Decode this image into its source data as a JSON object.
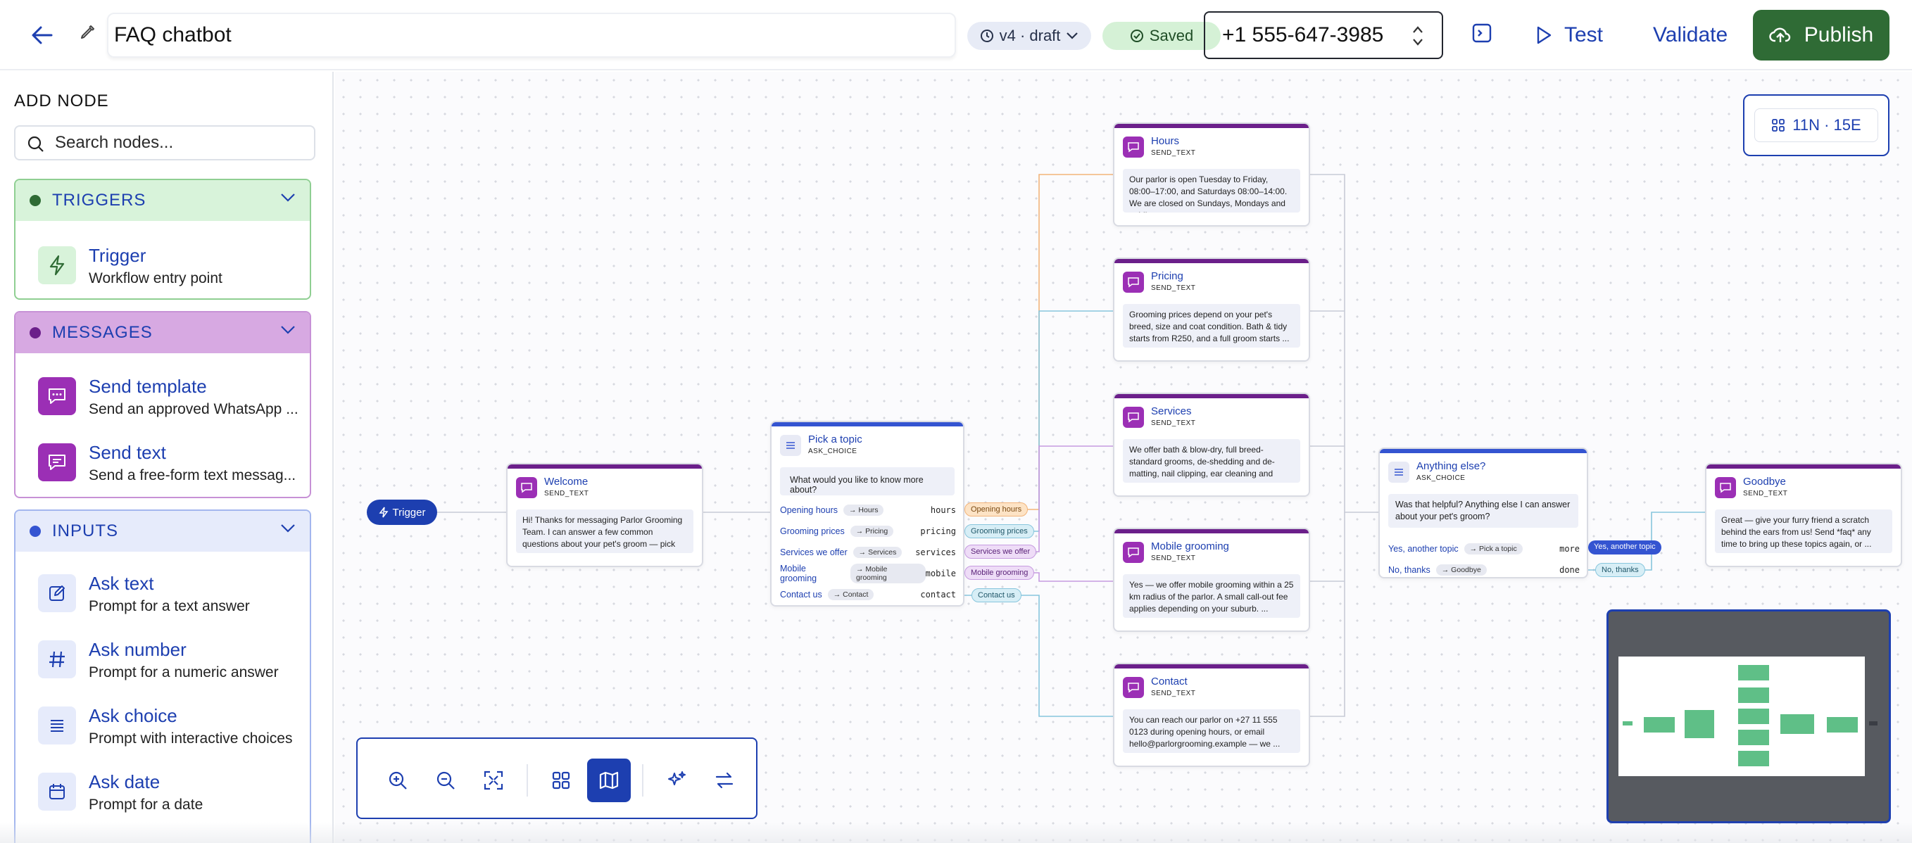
{
  "topbar": {
    "title": "FAQ chatbot",
    "version": "v4 · draft",
    "saved": "Saved",
    "phone": "+1 555-647-3985",
    "test": "Test",
    "validate": "Validate",
    "publish": "Publish"
  },
  "sidebar": {
    "heading": "ADD NODE",
    "search_placeholder": "Search nodes...",
    "groups": {
      "triggers": {
        "title": "TRIGGERS",
        "color": "#2f6b35",
        "items": [
          {
            "label": "Trigger",
            "desc": "Workflow entry point",
            "icon": "lightning-icon"
          }
        ]
      },
      "messages": {
        "title": "MESSAGES",
        "color": "#6b1f8a",
        "items": [
          {
            "label": "Send template",
            "desc": "Send an approved WhatsApp ...",
            "icon": "chat-bubble-icon"
          },
          {
            "label": "Send text",
            "desc": "Send a free-form text messag...",
            "icon": "chat-bubble-icon"
          }
        ]
      },
      "inputs": {
        "title": "INPUTS",
        "color": "#3454d1",
        "items": [
          {
            "label": "Ask text",
            "desc": "Prompt for a text answer",
            "icon": "edit-icon"
          },
          {
            "label": "Ask number",
            "desc": "Prompt for a numeric answer",
            "icon": "hash-icon"
          },
          {
            "label": "Ask choice",
            "desc": "Prompt with interactive choices",
            "icon": "list-icon"
          },
          {
            "label": "Ask date",
            "desc": "Prompt for a date",
            "icon": "calendar-icon"
          }
        ]
      }
    }
  },
  "canvas": {
    "stats": "11N · 15E",
    "trigger_label": "Trigger",
    "nodes": {
      "welcome": {
        "title": "Welcome",
        "type": "SEND_TEXT",
        "body": "Hi! Thanks for messaging Parlor Grooming Team. I can answer a few common questions about your pet's groom — pick a..."
      },
      "pick": {
        "title": "Pick a topic",
        "type": "ASK_CHOICE",
        "question": "What would you like to know more about?",
        "choices": [
          {
            "label": "Opening hours",
            "target": "→ Hours",
            "value": "hours"
          },
          {
            "label": "Grooming prices",
            "target": "→ Pricing",
            "value": "pricing"
          },
          {
            "label": "Services we offer",
            "target": "→ Services",
            "value": "services"
          },
          {
            "label": "Mobile grooming",
            "target": "→ Mobile grooming",
            "value": "mobile"
          },
          {
            "label": "Contact us",
            "target": "→ Contact",
            "value": "contact"
          }
        ]
      },
      "hours": {
        "title": "Hours",
        "type": "SEND_TEXT",
        "body": "Our parlor is open Tuesday to Friday, 08:00–17:00, and Saturdays 08:00–14:00. We are closed on Sundays, Mondays and public ..."
      },
      "pricing": {
        "title": "Pricing",
        "type": "SEND_TEXT",
        "body": "Grooming prices depend on your pet's breed, size and coat condition. Bath & tidy starts from R250, and a full groom starts ..."
      },
      "services": {
        "title": "Services",
        "type": "SEND_TEXT",
        "body": "We offer bath & blow-dry, full breed-standard grooms, de-shedding and de-matting, nail clipping, ear cleaning and tee..."
      },
      "mobile": {
        "title": "Mobile grooming",
        "type": "SEND_TEXT",
        "body": "Yes — we offer mobile grooming within a 25 km radius of the parlor. A small call-out fee applies depending on your suburb. ..."
      },
      "contact": {
        "title": "Contact",
        "type": "SEND_TEXT",
        "body": "You can reach our parlor on +27 11 555 0123 during opening hours, or email hello@parlorgrooming.example — we ..."
      },
      "anything": {
        "title": "Anything else?",
        "type": "ASK_CHOICE",
        "question": "Was that helpful? Anything else I can answer about your pet's groom?",
        "choices": [
          {
            "label": "Yes, another topic",
            "target": "→ Pick a topic",
            "value": "more"
          },
          {
            "label": "No, thanks",
            "target": "→ Goodbye",
            "value": "done"
          }
        ]
      },
      "goodbye": {
        "title": "Goodbye",
        "type": "SEND_TEXT",
        "body": "Great — give your furry friend a scratch behind the ears from us! Send *faq* any time to bring up these topics again, or ..."
      }
    },
    "edge_labels": {
      "opening": "Opening hours",
      "grooming": "Grooming prices",
      "services": "Services we offer",
      "mobile": "Mobile grooming",
      "contact": "Contact us",
      "yes": "Yes, another topic",
      "no": "No, thanks"
    }
  },
  "colors": {
    "accent": "#1d3fb0",
    "publish": "#2f6b35",
    "message": "#6b1f8a",
    "minimap_node": "#5fbf87"
  }
}
